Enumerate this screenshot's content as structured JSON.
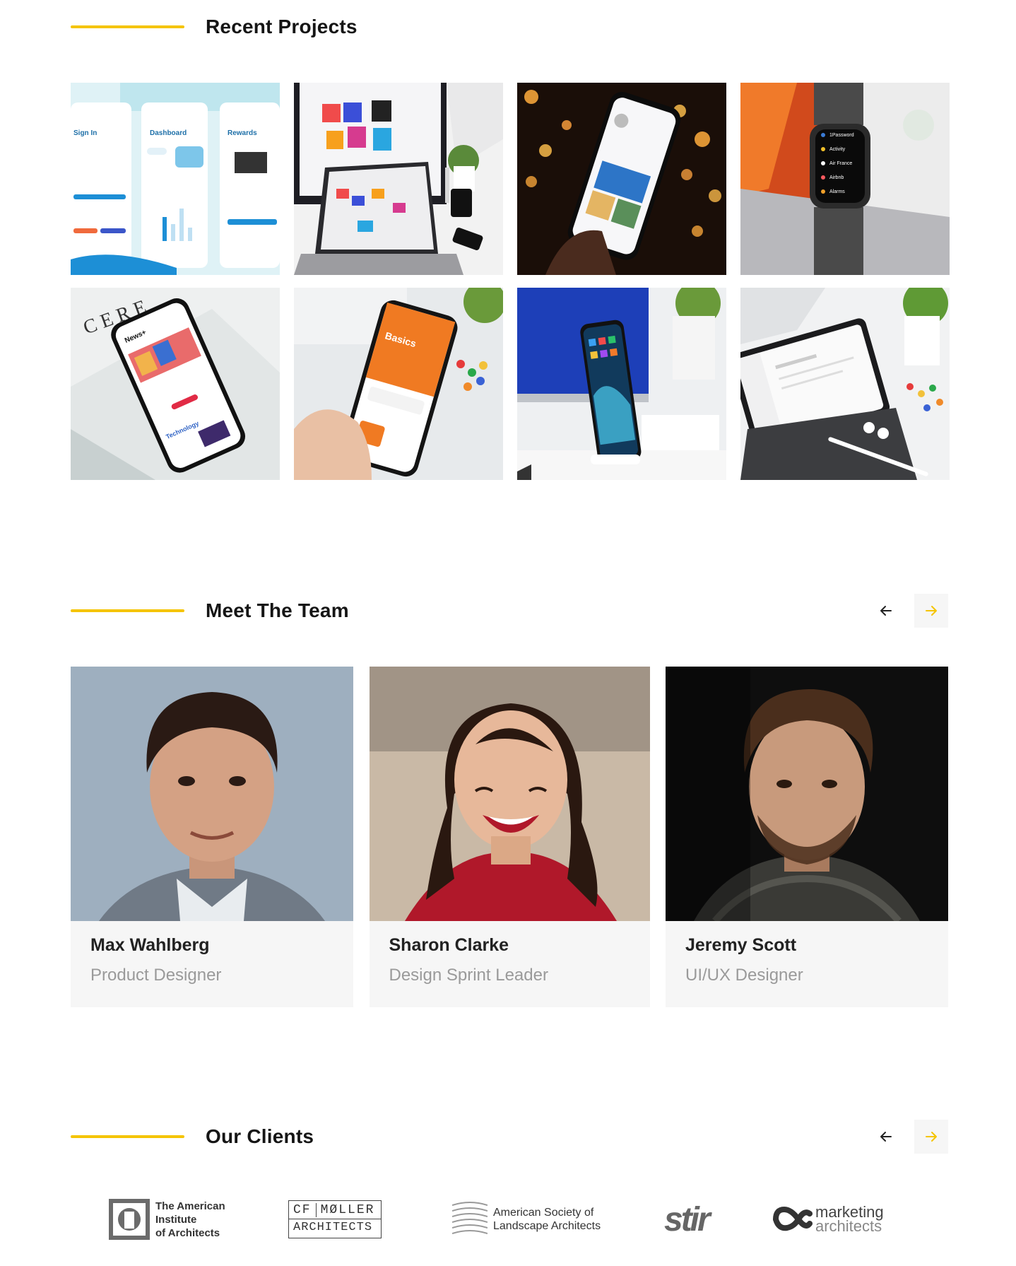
{
  "sections": {
    "projects": {
      "title": "Recent Projects"
    },
    "team": {
      "title": "Meet The Team"
    },
    "clients": {
      "title": "Our Clients"
    }
  },
  "project_tiles": {
    "tile1": {
      "label1": "Sign In",
      "label2": "Dashboard",
      "label3": "Rewards"
    },
    "tile4": {
      "items": [
        "1Password",
        "Activity",
        "Air France",
        "Airbnb",
        "Alarms"
      ]
    },
    "tile5": {
      "news": "News+",
      "tech": "Technology"
    },
    "tile6": {
      "basics": "Basics"
    }
  },
  "team": [
    {
      "name": "Max Wahlberg",
      "role": "Product Designer"
    },
    {
      "name": "Sharon Clarke",
      "role": "Design Sprint Leader"
    },
    {
      "name": "Jeremy Scott",
      "role": "UI/UX Designer"
    }
  ],
  "clients": {
    "aia": {
      "line1": "The American",
      "line2": "Institute",
      "line3": "of Architects"
    },
    "cfm": {
      "line1a": "CF",
      "line1b": "MØLLER",
      "line2": "ARCHITECTS"
    },
    "asla": {
      "line1": "American Society of",
      "line2": "Landscape Architects"
    },
    "stir": {
      "text": "stir"
    },
    "marketing": {
      "line1": "marketing",
      "line2": "architects"
    }
  },
  "colors": {
    "accent": "#f5c400",
    "card_bg": "#f6f6f6",
    "muted": "#9a9a9a"
  }
}
